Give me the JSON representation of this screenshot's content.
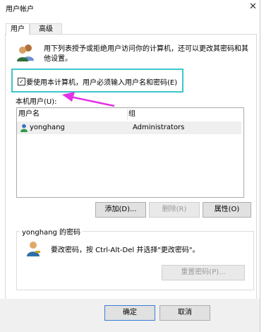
{
  "window": {
    "title": "用户帐户"
  },
  "tabs": [
    {
      "label": "用户"
    },
    {
      "label": "高级"
    }
  ],
  "description": "用下列表授予或拒绝用户访问你的计算机，还可以更改其密码和其他设置。",
  "must_enter_checkbox": {
    "label": "要使用本计算机，用户必须输入用户名和密码(E)",
    "checked": true
  },
  "users_list": {
    "label": "本机用户(U):",
    "columns": [
      "用户名",
      "组"
    ],
    "rows": [
      {
        "name": "yonghang",
        "group": "Administrators"
      }
    ]
  },
  "buttons": {
    "add": "添加(D)...",
    "remove": "删除(R)",
    "properties": "属性(O)"
  },
  "password_group": {
    "title": "yonghang 的密码",
    "text": "要改密码，按 Ctrl-Alt-Del 并选择\"更改密码\"。",
    "reset_button": "重置密码(P)..."
  },
  "footer": {
    "ok": "确定",
    "cancel": "取消"
  },
  "colors": {
    "highlight": "#3cc7cd",
    "arrow": "#e332e6",
    "selected_row": "#efefef"
  },
  "icons": [
    "close-icon",
    "users-icon",
    "user-icon",
    "key-user-icon",
    "arrow-annotation"
  ]
}
